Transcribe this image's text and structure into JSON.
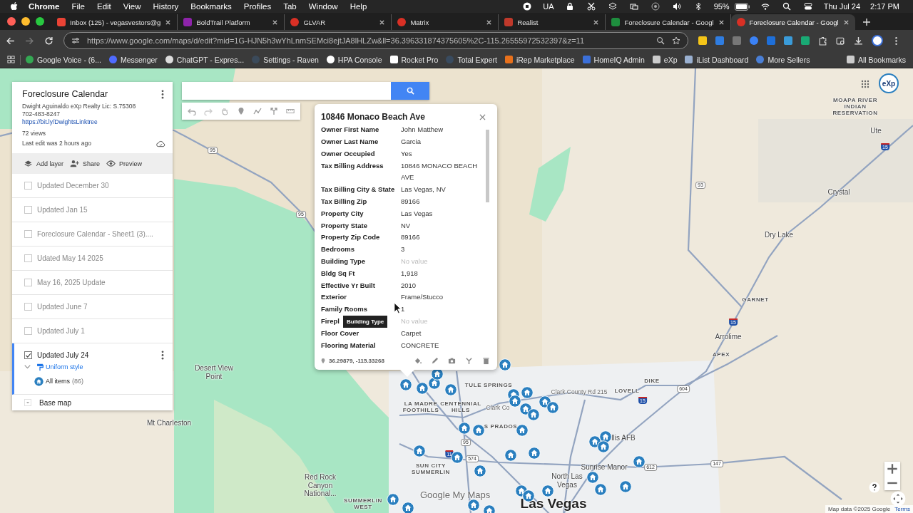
{
  "menu_bar": {
    "app": "Chrome",
    "items": [
      "File",
      "Edit",
      "View",
      "History",
      "Bookmarks",
      "Profiles",
      "Tab",
      "Window",
      "Help"
    ],
    "keyboard": "UA",
    "battery": "95%",
    "date": "Thu Jul 24",
    "time": "2:17 PM"
  },
  "tabs": [
    {
      "title": "Inbox (125) - vegasvestors@g",
      "kind": "mail",
      "selected": false
    },
    {
      "title": "BoldTrail Platform",
      "kind": "purple",
      "selected": false
    },
    {
      "title": "GLVAR",
      "kind": "red",
      "selected": false
    },
    {
      "title": "Matrix",
      "kind": "red",
      "selected": false
    },
    {
      "title": "Realist",
      "kind": "roof",
      "selected": false
    },
    {
      "title": "Foreclosure Calendar - Googl",
      "kind": "sheet",
      "selected": false
    },
    {
      "title": "Foreclosure Calendar - Googl",
      "kind": "pin",
      "selected": true
    }
  ],
  "address_bar": {
    "url": "https://www.google.com/maps/d/edit?mid=1G-HJN5h3wYhLnmSEMci8ejtJA8lHLZw&ll=36.396331874375605%2C-115.26555972532397&z=11"
  },
  "bookmarks": [
    {
      "label": "Google Voice - (6...",
      "kind": "phone"
    },
    {
      "label": "Messenger",
      "kind": "chat"
    },
    {
      "label": "ChatGPT - Expres...",
      "kind": "ring"
    },
    {
      "label": "Settings - Raven",
      "kind": "feather"
    },
    {
      "label": "HPA Console",
      "kind": "bars"
    },
    {
      "label": "Rocket Pro",
      "kind": "dark"
    },
    {
      "label": "Total Expert",
      "kind": "diamond"
    },
    {
      "label": "iRep Marketplace",
      "kind": "house"
    },
    {
      "label": "HomeIQ Admin",
      "kind": "iq"
    },
    {
      "label": "eXp",
      "kind": "folder"
    },
    {
      "label": "iList Dashboard",
      "kind": "page"
    },
    {
      "label": "More Sellers",
      "kind": "badge"
    }
  ],
  "all_bookmarks": "All Bookmarks",
  "map_panel": {
    "title": "Foreclosure Calendar",
    "description": [
      "Dwight Aguinaldo eXp Realty Lic: S.75308",
      "702-483-8247"
    ],
    "link": "https://bit.ly/DwightsLinktree",
    "views": "72 views",
    "last_edit": "Last edit was 2 hours ago",
    "actions": [
      "Add layer",
      "Share",
      "Preview"
    ],
    "layers": [
      {
        "name": "Updated December 30",
        "checked": false,
        "selected": false
      },
      {
        "name": "Updated Jan 15",
        "checked": false,
        "selected": false
      },
      {
        "name": "Foreclosure Calendar - Sheet1 (3)....",
        "checked": false,
        "selected": false
      },
      {
        "name": "Udated May 14 2025",
        "checked": false,
        "selected": false
      },
      {
        "name": "May 16, 2025 Update",
        "checked": false,
        "selected": false
      },
      {
        "name": "Updated June 7",
        "checked": false,
        "selected": false
      },
      {
        "name": "Updated July 1",
        "checked": false,
        "selected": false
      },
      {
        "name": "Updated July 24",
        "checked": true,
        "selected": true
      }
    ],
    "style": "Uniform style",
    "items_label": "All items",
    "items_count": "(86)",
    "base_map": "Base map"
  },
  "info_window": {
    "title": "10846 Monaco Beach Ave",
    "fields": [
      {
        "label": "Owner First Name",
        "value": "John Matthew",
        "empty": false
      },
      {
        "label": "Owner Last Name",
        "value": "Garcia",
        "empty": false
      },
      {
        "label": "Owner Occupied",
        "value": "Yes",
        "empty": false
      },
      {
        "label": "Tax Billing Address",
        "value": "10846 MONACO BEACH AVE",
        "empty": false
      },
      {
        "label": "Tax Billing City & State",
        "value": "Las Vegas, NV",
        "empty": false
      },
      {
        "label": "Tax Billing Zip",
        "value": "89166",
        "empty": false
      },
      {
        "label": "Property City",
        "value": "Las Vegas",
        "empty": false
      },
      {
        "label": "Property State",
        "value": "NV",
        "empty": false
      },
      {
        "label": "Property Zip Code",
        "value": "89166",
        "empty": false
      },
      {
        "label": "Bedrooms",
        "value": "3",
        "empty": false
      },
      {
        "label": "Building Type",
        "value": "No value",
        "empty": true
      },
      {
        "label": "Bldg Sq Ft",
        "value": "1,918",
        "empty": false
      },
      {
        "label": "Effective Yr Built",
        "value": "2010",
        "empty": false
      },
      {
        "label": "Exterior",
        "value": "Frame/Stucco",
        "empty": false
      },
      {
        "label": "Family Rooms",
        "value": "1",
        "empty": false
      },
      {
        "label": "Firepl",
        "value": "No value",
        "empty": true
      },
      {
        "label": "Floor Cover",
        "value": "Carpet",
        "empty": false
      },
      {
        "label": "Flooring Material",
        "value": "CONCRETE",
        "empty": false
      }
    ],
    "tooltip": "Building Type",
    "coordinates": "36.29879, -115.33268"
  },
  "map_labels": [
    {
      "text": "Desert View Point",
      "kind": "place"
    },
    {
      "text": "Mt Charleston",
      "kind": "place"
    },
    {
      "text": "Red Rock Canyon National...",
      "kind": "place"
    },
    {
      "text": "TULE SPRINGS",
      "kind": "area"
    },
    {
      "text": "LA MADRE FOOTHILLS",
      "kind": "area"
    },
    {
      "text": "CENTENNIAL HILLS",
      "kind": "area"
    },
    {
      "text": "S PRADOS",
      "kind": "area"
    },
    {
      "text": "SUN CITY SUMMERLIN",
      "kind": "area"
    },
    {
      "text": "North Las Vegas",
      "kind": "place"
    },
    {
      "text": "Sunrise Manor",
      "kind": "place"
    },
    {
      "text": "Las Vegas",
      "kind": "city"
    },
    {
      "text": "LOVELL",
      "kind": "area"
    },
    {
      "text": "DIKE",
      "kind": "area"
    },
    {
      "text": "APEX",
      "kind": "area"
    },
    {
      "text": "GARNET",
      "kind": "area"
    },
    {
      "text": "Arrolime",
      "kind": "place"
    },
    {
      "text": "Dry Lake",
      "kind": "place"
    },
    {
      "text": "Crystal",
      "kind": "place"
    },
    {
      "text": "Ute",
      "kind": "place"
    },
    {
      "text": "MOAPA RIVER INDIAN RESERVATION",
      "kind": "area"
    },
    {
      "text": "Clark County Rd 215",
      "kind": "road"
    },
    {
      "text": "Clark Co",
      "kind": "road"
    },
    {
      "text": "llis AFB",
      "kind": "place"
    },
    {
      "text": "SUMMERLIN WEST",
      "kind": "area"
    },
    {
      "text": "95",
      "kind": "us"
    },
    {
      "text": "95",
      "kind": "us"
    },
    {
      "text": "93",
      "kind": "us"
    },
    {
      "text": "15",
      "kind": "interstate"
    },
    {
      "text": "15",
      "kind": "interstate"
    },
    {
      "text": "604",
      "kind": "us"
    },
    {
      "text": "15",
      "kind": "interstate"
    },
    {
      "text": "95",
      "kind": "us"
    },
    {
      "text": "574",
      "kind": "us"
    },
    {
      "text": "11",
      "kind": "interstate"
    },
    {
      "text": "612",
      "kind": "us"
    },
    {
      "text": "147",
      "kind": "us"
    }
  ],
  "map_logo": "Google My Maps",
  "profile_badge": "eXp",
  "attribution": {
    "copyright": "Map data ©2025 Google",
    "terms": "Terms"
  }
}
